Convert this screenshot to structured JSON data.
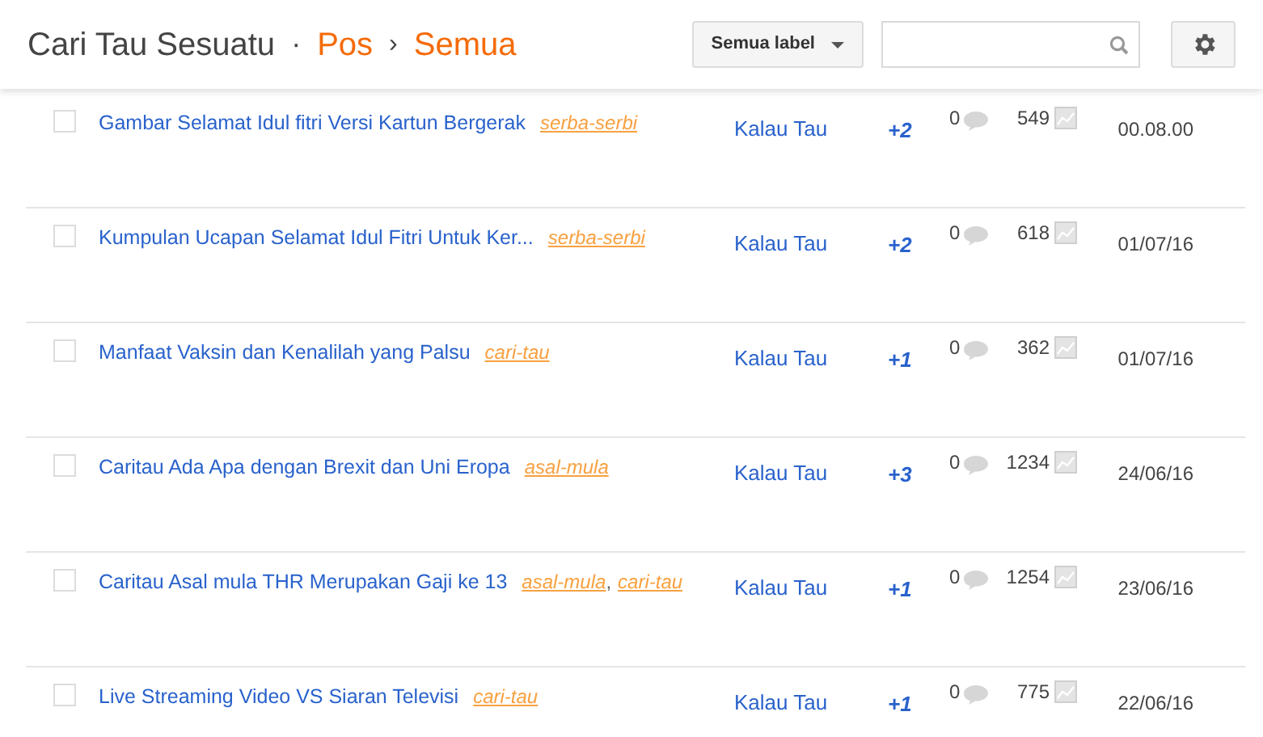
{
  "header": {
    "blog_title": "Cari Tau Sesuatu",
    "separator": "·",
    "breadcrumb": [
      {
        "label": "Pos"
      },
      {
        "label": "Semua"
      }
    ],
    "breadcrumb_separator": "›",
    "label_filter": "Semua label"
  },
  "label_separator": ",",
  "posts": [
    {
      "title": "Gambar Selamat Idul fitri Versi Kartun Bergerak",
      "labels": [
        "serba-serbi"
      ],
      "author": "Kalau Tau",
      "plus": "+2",
      "comments": "0",
      "views": "549",
      "date": "00.08.00",
      "checked": false
    },
    {
      "title": "Kumpulan Ucapan Selamat Idul Fitri Untuk Ker...",
      "labels": [
        "serba-serbi"
      ],
      "author": "Kalau Tau",
      "plus": "+2",
      "comments": "0",
      "views": "618",
      "date": "01/07/16",
      "checked": false
    },
    {
      "title": "Manfaat Vaksin dan Kenalilah yang Palsu",
      "labels": [
        "cari-tau"
      ],
      "author": "Kalau Tau",
      "plus": "+1",
      "comments": "0",
      "views": "362",
      "date": "01/07/16",
      "checked": false
    },
    {
      "title": "Caritau Ada Apa dengan Brexit dan Uni Eropa",
      "labels": [
        "asal-mula"
      ],
      "author": "Kalau Tau",
      "plus": "+3",
      "comments": "0",
      "views": "1234",
      "date": "24/06/16",
      "checked": false
    },
    {
      "title": "Caritau Asal mula THR Merupakan Gaji ke 13",
      "labels": [
        "asal-mula",
        "cari-tau"
      ],
      "author": "Kalau Tau",
      "plus": "+1",
      "comments": "0",
      "views": "1254",
      "date": "23/06/16",
      "checked": false
    },
    {
      "title": "Live Streaming Video VS Siaran Televisi",
      "labels": [
        "cari-tau"
      ],
      "author": "Kalau Tau",
      "plus": "+1",
      "comments": "0",
      "views": "775",
      "date": "22/06/16",
      "checked": false
    }
  ]
}
